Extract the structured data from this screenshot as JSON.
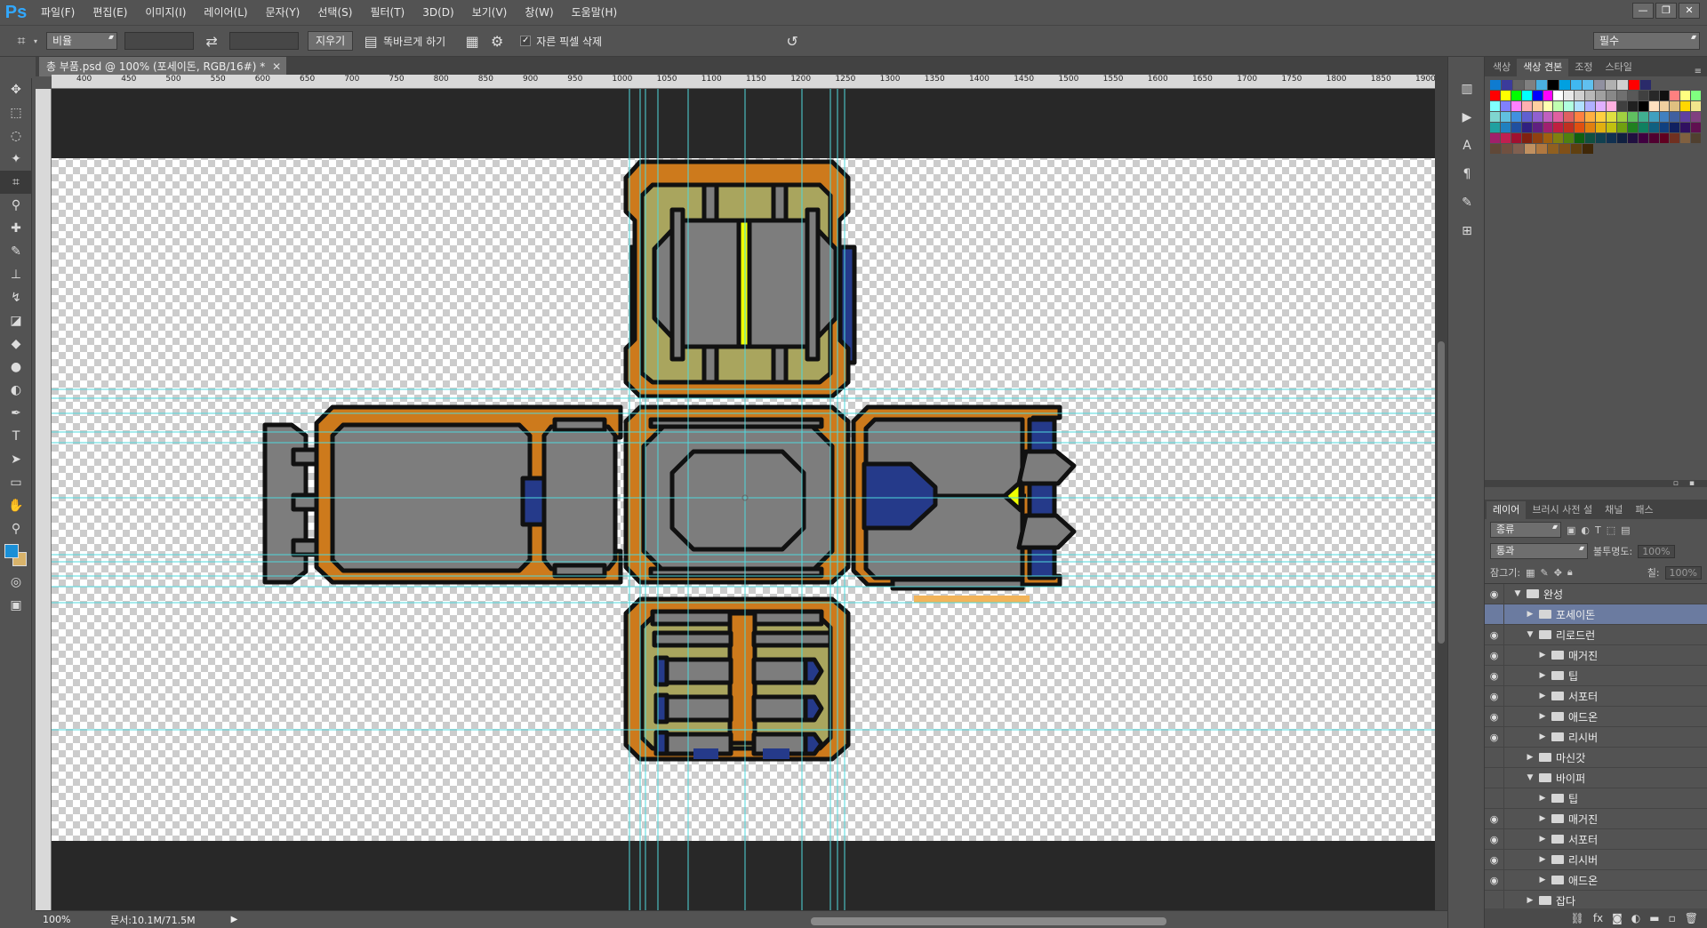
{
  "menubar": {
    "logo": "Ps",
    "items": [
      "파일(F)",
      "편집(E)",
      "이미지(I)",
      "레이어(L)",
      "문자(Y)",
      "선택(S)",
      "필터(T)",
      "3D(D)",
      "보기(V)",
      "창(W)",
      "도움말(H)"
    ],
    "window_controls": [
      "—",
      "❐",
      "✕"
    ]
  },
  "options": {
    "ratio_select": "비율",
    "swap_icon": "⇄",
    "clear_button": "지우기",
    "straighten_label": "똑바르게 하기",
    "delete_cropped_label": "자른 픽셀 삭제",
    "workspace_select": "필수"
  },
  "document": {
    "tab_title": "총 부품.psd @ 100% (포세이돈, RGB/16#) *",
    "zoom": "100%",
    "doc_size": "문서:10.1M/71.5M"
  },
  "ruler": {
    "ticks": [
      "400",
      "450",
      "500",
      "550",
      "600",
      "650",
      "700",
      "750",
      "800",
      "850",
      "900",
      "950",
      "1000",
      "1050",
      "1100",
      "1150",
      "1200",
      "1250",
      "1300",
      "1350",
      "1400",
      "1450",
      "1500",
      "1550",
      "1600",
      "1650",
      "1700",
      "1750",
      "1800",
      "1850",
      "1900"
    ]
  },
  "swatches_panel": {
    "tabs": [
      "색상",
      "색상 견본",
      "조정",
      "스타일"
    ],
    "colors": [
      [
        "#0f7bd0",
        "#3b3b9b",
        "#646464",
        "#808080",
        "#4ab0e0",
        "#000000",
        "#00a0e0",
        "#40b8f0",
        "#60c0f0",
        "#9090a0",
        "#b0b0b0",
        "#d0d0d0",
        "#ff0000",
        "#2a2a6a"
      ],
      [
        "#ff0000",
        "#ffff00",
        "#00ff00",
        "#00ffff",
        "#0000ff",
        "#ff00ff",
        "#ffffff",
        "#e8e8e8",
        "#d0d0d0",
        "#b8b8b8",
        "#a0a0a0",
        "#888888",
        "#707070",
        "#585858",
        "#404040",
        "#282828",
        "#101010",
        "#ff8080",
        "#ffff80",
        "#80ff80"
      ],
      [
        "#80ffff",
        "#8080ff",
        "#ff80ff",
        "#ffb0b0",
        "#ffd0a0",
        "#ffffb0",
        "#c0ffb0",
        "#b0ffe0",
        "#b0e0ff",
        "#b0b0ff",
        "#e0b0ff",
        "#ffb0e0",
        "#404040",
        "#202020",
        "#000000",
        "#ffe0c0",
        "#f0d0a0",
        "#e0c080",
        "#ffd700",
        "#f0e68c"
      ],
      [
        "#7fd6d0",
        "#60c0e0",
        "#4090e0",
        "#6060d0",
        "#9060d0",
        "#c060c0",
        "#e060a0",
        "#e06060",
        "#ff8040",
        "#ffb040",
        "#ffd040",
        "#e0e040",
        "#a0d040",
        "#60c060",
        "#40b090",
        "#40a0c0",
        "#4080c0",
        "#4060a0",
        "#6040a0",
        "#804080"
      ],
      [
        "#20a0a0",
        "#2080c0",
        "#2050a0",
        "#302080",
        "#602080",
        "#a02070",
        "#c02040",
        "#c03020",
        "#e05010",
        "#e08010",
        "#e0b010",
        "#c0c010",
        "#70a010",
        "#208020",
        "#108060",
        "#106080",
        "#104080",
        "#102060",
        "#301060",
        "#601050"
      ],
      [
        "#a0206a",
        "#c02050",
        "#a01030",
        "#802010",
        "#904010",
        "#a06010",
        "#808010",
        "#508010",
        "#106010",
        "#105040",
        "#104050",
        "#103050",
        "#102040",
        "#201040",
        "#400040",
        "#500030",
        "#600020",
        "#703020",
        "#806040",
        "#504030"
      ],
      [
        "#604838",
        "#705040",
        "#806050",
        "#c09060",
        "#b07840",
        "#906020",
        "#805018",
        "#604010",
        "#402808"
      ]
    ]
  },
  "layers_panel": {
    "tabs": [
      "레이어",
      "브러시 사전 설",
      "채널",
      "패스"
    ],
    "filter_select": "종류",
    "blend_select": "통과",
    "opacity_label": "불투명도:",
    "opacity_value": "100%",
    "lock_label": "잠그기:",
    "fill_label": "칠:",
    "fill_value": "100%",
    "layers": [
      {
        "name": "완성",
        "indent": 0,
        "open": true,
        "visible": true,
        "selected": false
      },
      {
        "name": "포세이돈",
        "indent": 1,
        "open": false,
        "visible": false,
        "selected": true
      },
      {
        "name": "리로드런",
        "indent": 1,
        "open": true,
        "visible": true,
        "selected": false
      },
      {
        "name": "매거진",
        "indent": 2,
        "open": false,
        "visible": true,
        "selected": false
      },
      {
        "name": "팁",
        "indent": 2,
        "open": false,
        "visible": true,
        "selected": false
      },
      {
        "name": "서포터",
        "indent": 2,
        "open": false,
        "visible": true,
        "selected": false
      },
      {
        "name": "애드온",
        "indent": 2,
        "open": false,
        "visible": true,
        "selected": false
      },
      {
        "name": "리시버",
        "indent": 2,
        "open": false,
        "visible": true,
        "selected": false
      },
      {
        "name": "마신갓",
        "indent": 1,
        "open": false,
        "visible": false,
        "selected": false
      },
      {
        "name": "바이퍼",
        "indent": 1,
        "open": true,
        "visible": false,
        "selected": false
      },
      {
        "name": "팁",
        "indent": 2,
        "open": false,
        "visible": false,
        "selected": false
      },
      {
        "name": "매거진",
        "indent": 2,
        "open": false,
        "visible": true,
        "selected": false
      },
      {
        "name": "서포터",
        "indent": 2,
        "open": false,
        "visible": true,
        "selected": false
      },
      {
        "name": "리시버",
        "indent": 2,
        "open": false,
        "visible": true,
        "selected": false
      },
      {
        "name": "애드온",
        "indent": 2,
        "open": false,
        "visible": true,
        "selected": false
      },
      {
        "name": "잡다",
        "indent": 1,
        "open": false,
        "visible": false,
        "selected": false
      }
    ]
  },
  "colors": {
    "orange": "#cd7a1c",
    "khaki": "#a9a55e",
    "gray": "#7d7d7d",
    "navy": "#253a8a",
    "yellow": "#f0ff00",
    "guide": "#4fd8dc",
    "light_orange": "#f2b45a"
  }
}
